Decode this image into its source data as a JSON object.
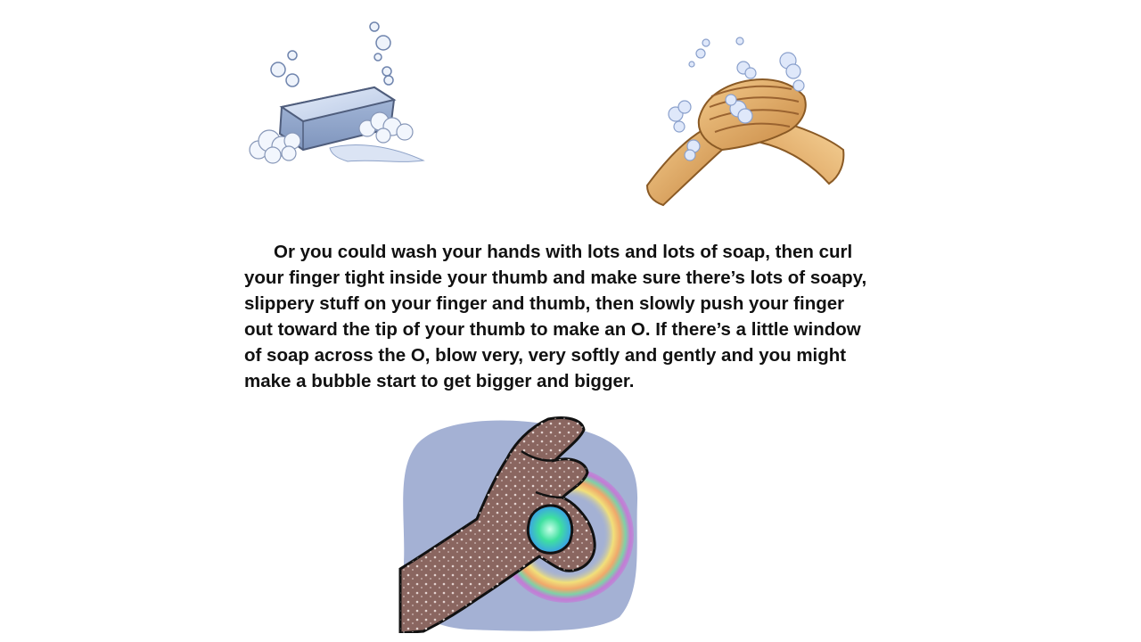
{
  "slide": {
    "paragraph": "Or you could wash your hands with lots and lots of soap, then curl your finger tight inside your thumb and make sure there’s lots of soapy, slippery stuff on your finger and thumb, then slowly push your finger out toward the tip of your thumb to make an O.  If there’s a little window of soap across the O, blow very, very softly and gently and you might make a bubble start to get bigger and bigger."
  },
  "illustrations": {
    "top_left": "soap-bar-with-bubbles",
    "top_right": "hands-washing-with-lather",
    "bottom": "soapy-hand-making-bubble"
  },
  "colors": {
    "background": "#ffffff",
    "text": "#111111",
    "soap": "#b8c9e6",
    "lather": "#dfe7f7",
    "skin_light": "#e7b46a",
    "skin_dark": "#8a6660",
    "bubble_backdrop": "#a4b1d4"
  }
}
